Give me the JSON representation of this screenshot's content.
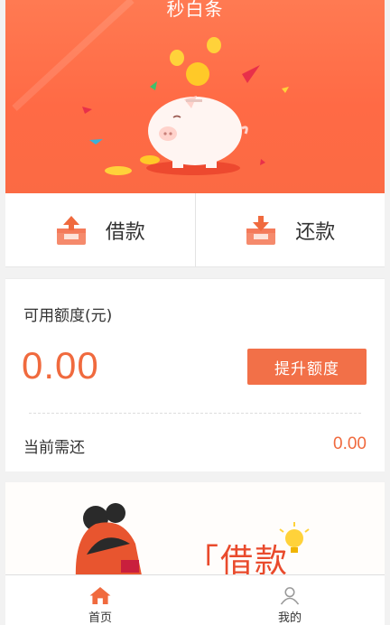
{
  "header": {
    "title": "秒白条"
  },
  "actions": {
    "borrow_label": "借款",
    "repay_label": "还款"
  },
  "credit": {
    "available_label": "可用额度(元)",
    "available_amount": "0.00",
    "raise_button_label": "提升额度",
    "due_label": "当前需还",
    "due_amount": "0.00"
  },
  "banner": {
    "text": "「借款"
  },
  "tabbar": {
    "tabs": [
      {
        "label": "首页",
        "icon": "home-icon",
        "active": true
      },
      {
        "label": "我的",
        "icon": "profile-icon",
        "active": false
      }
    ]
  },
  "colors": {
    "brand_orange": "#ff6a45",
    "accent_text": "#f06a3e",
    "button": "#f27048"
  }
}
